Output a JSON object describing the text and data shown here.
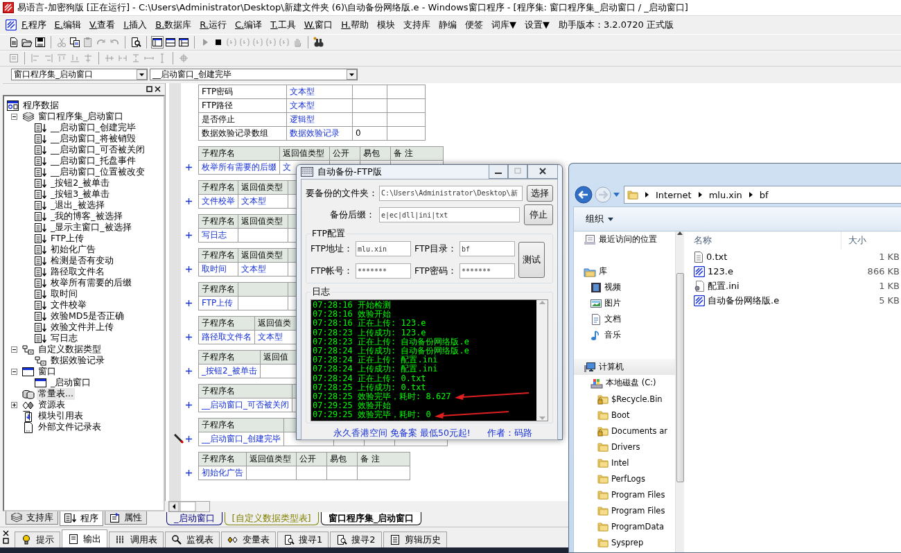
{
  "window": {
    "title": "易语言-加密狗版 [正在运行] - C:\\Users\\Administrator\\Desktop\\新建文件夹 (6)\\自动备份网络版.e - Windows窗口程序 - [程序集: 窗口程序集_启动窗口 / _启动窗口]"
  },
  "menu": [
    {
      "label": "F.程序",
      "kind": "hotkey"
    },
    {
      "label": "E.编辑",
      "kind": "hotkey"
    },
    {
      "label": "V.查看",
      "kind": "hotkey"
    },
    {
      "label": "I.插入",
      "kind": "hotkey"
    },
    {
      "label": "B.数据库",
      "kind": "hotkey"
    },
    {
      "label": "R.运行",
      "kind": "hotkey"
    },
    {
      "label": "C.编译",
      "kind": "hotkey"
    },
    {
      "label": "T.工具",
      "kind": "hotkey"
    },
    {
      "label": "W.窗口",
      "kind": "hotkey"
    },
    {
      "label": "H.帮助",
      "kind": "hotkey"
    },
    {
      "label": "模块",
      "kind": "plain"
    },
    {
      "label": "支持库",
      "kind": "plain"
    },
    {
      "label": "静编",
      "kind": "plain"
    },
    {
      "label": "便签",
      "kind": "plain"
    },
    {
      "label": "词库▼",
      "kind": "plain"
    },
    {
      "label": "设置▼",
      "kind": "plain"
    }
  ],
  "version_label": "助手版本：3.2.0720 正式版",
  "selectors": [
    {
      "value": "窗口程序集_启动窗口"
    },
    {
      "value": "__启动窗口_创建完毕"
    }
  ],
  "project_tree": {
    "nodes": [
      {
        "label": "程序数据",
        "kind": "root",
        "selected": false,
        "children": [
          {
            "label": "窗口程序集_启动窗口",
            "kind": "assembly",
            "selected": false,
            "expanded": true,
            "children": [
              {
                "label": "__启动窗口_创建完毕",
                "kind": "sub",
                "selected": false
              },
              {
                "label": "__启动窗口_将被销毁",
                "kind": "sub",
                "selected": false
              },
              {
                "label": "__启动窗口_可否被关闭",
                "kind": "sub",
                "selected": false
              },
              {
                "label": "__启动窗口_托盘事件",
                "kind": "sub",
                "selected": false
              },
              {
                "label": "__启动窗口_位置被改变",
                "kind": "sub",
                "selected": false
              },
              {
                "label": "_按钮2_被单击",
                "kind": "sub",
                "selected": false
              },
              {
                "label": "_按钮3_被单击",
                "kind": "sub",
                "selected": false
              },
              {
                "label": "_退出_被选择",
                "kind": "sub",
                "selected": false
              },
              {
                "label": "_我的博客_被选择",
                "kind": "sub",
                "selected": false
              },
              {
                "label": "_显示主窗口_被选择",
                "kind": "sub",
                "selected": false
              },
              {
                "label": "FTP上传",
                "kind": "sub",
                "selected": false
              },
              {
                "label": "初始化广告",
                "kind": "sub",
                "selected": false
              },
              {
                "label": "检测是否有变动",
                "kind": "sub",
                "selected": false
              },
              {
                "label": "路径取文件名",
                "kind": "sub",
                "selected": false
              },
              {
                "label": "枚举所有需要的后缀",
                "kind": "sub",
                "selected": false
              },
              {
                "label": "取时间",
                "kind": "sub",
                "selected": false
              },
              {
                "label": "文件校举",
                "kind": "sub",
                "selected": false
              },
              {
                "label": "效验MD5是否正确",
                "kind": "sub",
                "selected": false
              },
              {
                "label": "效验文件并上传",
                "kind": "sub",
                "selected": false
              },
              {
                "label": "写日志",
                "kind": "sub",
                "selected": false
              }
            ]
          },
          {
            "label": "自定义数据类型",
            "kind": "type",
            "selected": false,
            "expanded": true,
            "children": [
              {
                "label": "数据效验记录",
                "kind": "type",
                "selected": false
              }
            ]
          },
          {
            "label": "窗口",
            "kind": "window",
            "selected": false,
            "expanded": true,
            "children": [
              {
                "label": "_启动窗口",
                "kind": "window",
                "selected": false
              }
            ]
          },
          {
            "label": "常量表...",
            "kind": "constants",
            "selected": true
          },
          {
            "label": "资源表",
            "kind": "resources",
            "selected": false,
            "expanded": false
          },
          {
            "label": "模块引用表",
            "kind": "modules",
            "selected": false
          },
          {
            "label": "外部文件记录表",
            "kind": "file",
            "selected": false
          }
        ]
      }
    ]
  },
  "panel_tabs": [
    {
      "label": "支持库",
      "kind": "library",
      "selected": false
    },
    {
      "label": "程序",
      "kind": "program",
      "selected": true
    },
    {
      "label": "属性",
      "kind": "properties",
      "selected": false
    }
  ],
  "code": {
    "variable_rows": [
      [
        "FTP密码",
        "文本型"
      ],
      [
        "FTP路径",
        "文本型"
      ],
      [
        "是否停止",
        "逻辑型"
      ],
      [
        "数据效验记录数组",
        "数据效验记录",
        "0"
      ]
    ],
    "subroutines": [
      {
        "headers": [
          "子程序名",
          "返回值类型",
          "公开",
          "易包",
          "备 注"
        ],
        "cells": [
          "枚举所有需要的后缀",
          "文"
        ],
        "editing": false
      },
      {
        "headers": [
          "子程序名",
          "返回值类型"
        ],
        "cells": [
          "文件校举",
          "文本型"
        ],
        "editing": false
      },
      {
        "headers": [
          "子程序名",
          "返回值类型"
        ],
        "cells": [
          "写日志"
        ],
        "editing": false
      },
      {
        "headers": [
          "子程序名",
          "返回值类型"
        ],
        "cells": [
          "取时间",
          "文本型"
        ],
        "editing": false
      },
      {
        "headers": [
          "子程序名"
        ],
        "cells": [
          "FTP上传"
        ],
        "editing": false
      },
      {
        "headers": [
          "子程序名",
          "返回值类"
        ],
        "cells": [
          "路径取文件名",
          "文本型"
        ],
        "editing": false
      },
      {
        "headers": [
          "子程序名",
          "返回值"
        ],
        "cells": [
          "_按钮2_被单击"
        ],
        "editing": false
      },
      {
        "headers": [
          "子程序名"
        ],
        "cells": [
          "__启动窗口_可否被关闭"
        ],
        "editing": false
      },
      {
        "headers": [
          "子程序名"
        ],
        "cells": [
          "__启动窗口_创建完毕"
        ],
        "editing": true
      },
      {
        "headers": [
          "子程序名",
          "返回值类型",
          "公开",
          "易包",
          "备 注"
        ],
        "cells": [
          "初始化广告"
        ],
        "editing": false
      }
    ]
  },
  "editor_tabs": [
    {
      "label": "_启动窗口",
      "color": "#000080",
      "selected": false
    },
    {
      "label": "[自定义数据类型表]",
      "color": "#808000",
      "selected": false
    },
    {
      "label": "窗口程序集_启动窗口",
      "color": "#000000",
      "selected": true
    }
  ],
  "output_tabs": [
    {
      "label": "提示",
      "kind": "hint",
      "selected": false
    },
    {
      "label": "输出",
      "kind": "output",
      "selected": true
    },
    {
      "label": "调用表",
      "kind": "calls",
      "selected": false
    },
    {
      "label": "监视表",
      "kind": "watch",
      "selected": false
    },
    {
      "label": "变量表",
      "kind": "variables",
      "selected": false
    },
    {
      "label": "搜寻1",
      "kind": "search",
      "selected": false
    },
    {
      "label": "搜寻2",
      "kind": "search",
      "selected": false
    },
    {
      "label": "剪辑历史",
      "kind": "clips",
      "selected": false
    }
  ],
  "ftp_dialog": {
    "title": "自动备份-FTP版",
    "fields": [
      {
        "label": "要备份的文件夹：",
        "value": "C:\\Users\\Administrator\\Desktop\\新"
      },
      {
        "label": "备份后缀：",
        "value": "e|ec|dll|ini|txt"
      }
    ],
    "buttons": [
      "选择",
      "停止"
    ],
    "ftp_group": {
      "title": "FTP配置",
      "fields": [
        {
          "label": "FTP地址：",
          "value": "mlu.xin"
        },
        {
          "label": "FTP目录：",
          "value": "bf"
        },
        {
          "label": "FTP帐号：",
          "value": "*******"
        },
        {
          "label": "FTP密码：",
          "value": "*******"
        }
      ],
      "button": "测试"
    },
    "log": {
      "title": "日志",
      "lines": [
        {
          "text": "07:28:16 开始检测",
          "marked": false
        },
        {
          "text": "07:28:16 效验开始",
          "marked": false
        },
        {
          "text": "07:28:16 正在上传: 123.e",
          "marked": false
        },
        {
          "text": "07:28:23 上传成功: 123.e",
          "marked": false
        },
        {
          "text": "07:28:23 正在上传: 自动备份网络版.e",
          "marked": false
        },
        {
          "text": "07:28:24 上传成功: 自动备份网络版.e",
          "marked": false
        },
        {
          "text": "07:28:24 正在上传: 配置.ini",
          "marked": false
        },
        {
          "text": "07:28:24 上传成功: 配置.ini",
          "marked": false
        },
        {
          "text": "07:28:24 正在上传: 0.txt",
          "marked": false
        },
        {
          "text": "07:28:25 上传成功: 0.txt",
          "marked": false
        },
        {
          "text": "07:28:25 效验完毕，耗时: 8.627",
          "marked": true
        },
        {
          "text": "07:29:25 效验开始",
          "marked": false
        },
        {
          "text": "07:29:25 效验完毕，耗时: 0",
          "marked": true
        }
      ]
    },
    "footer": {
      "link": "永久香港空间 免备案 最低50元起!",
      "author": "作者：码路"
    }
  },
  "explorer": {
    "path": [
      "Internet",
      "mlu.xin",
      "bf"
    ],
    "organize": "组织",
    "nav": [
      {
        "label": "最近访问的位置",
        "kind": "recent"
      },
      {
        "label": "库",
        "kind": "library",
        "children": [
          {
            "label": "视频",
            "kind": "video"
          },
          {
            "label": "图片",
            "kind": "pictures"
          },
          {
            "label": "文档",
            "kind": "documents"
          },
          {
            "label": "音乐",
            "kind": "music"
          }
        ]
      },
      {
        "label": "计算机",
        "kind": "computer",
        "children": [
          {
            "label": "本地磁盘 (C:)",
            "kind": "drive",
            "children": [
              {
                "label": "$Recycle.Bin",
                "kind": "locked-folder"
              },
              {
                "label": "Boot",
                "kind": "folder"
              },
              {
                "label": "Documents ar",
                "kind": "locked-folder"
              },
              {
                "label": "Drivers",
                "kind": "folder"
              },
              {
                "label": "Intel",
                "kind": "folder"
              },
              {
                "label": "PerfLogs",
                "kind": "folder"
              },
              {
                "label": "Program Files",
                "kind": "folder"
              },
              {
                "label": "Program Files",
                "kind": "folder"
              },
              {
                "label": "ProgramData",
                "kind": "folder"
              },
              {
                "label": "Sysprep",
                "kind": "folder"
              }
            ]
          }
        ]
      }
    ],
    "columns": [
      "名称",
      "大小"
    ],
    "files": [
      {
        "name": "0.txt",
        "size": "1 KB",
        "kind": "text"
      },
      {
        "name": "123.e",
        "size": "866 KB",
        "kind": "e-source"
      },
      {
        "name": "配置.ini",
        "size": "1 KB",
        "kind": "settings"
      },
      {
        "name": "自动备份网络版.e",
        "size": "5 KB",
        "kind": "e-source"
      }
    ]
  }
}
